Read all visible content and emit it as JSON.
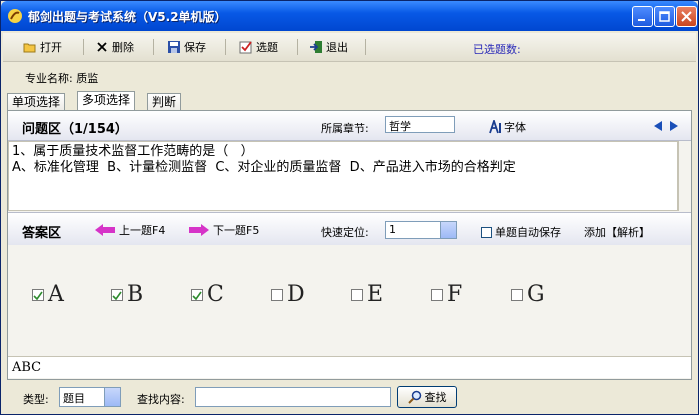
{
  "window": {
    "title": "郁剑出题与考试系统（V5.2单机版）"
  },
  "toolbar": {
    "open_label": "打开",
    "delete_label": "删除",
    "save_label": "保存",
    "select_label": "选题",
    "exit_label": "退出",
    "selected_count_label": "已选题数:"
  },
  "major": {
    "label": "专业名称: 质监"
  },
  "tabs": [
    {
      "label": "单项选择",
      "active": false
    },
    {
      "label": "多项选择",
      "active": true
    },
    {
      "label": "判断",
      "active": false
    }
  ],
  "question": {
    "area_title": "问题区（1/154）",
    "chapter_label": "所属章节:",
    "chapter_value": "哲学",
    "font_label": "字体",
    "text": "1、属于质量技术监督工作范畴的是（   ）\nA、标准化管理  B、计量检测监督  C、对企业的质量监督  D、产品进入市场的合格判定"
  },
  "answer": {
    "area_title": "答案区",
    "prev_label": "上一题F4",
    "next_label": "下一题F5",
    "locate_label": "快速定位:",
    "locate_value": "1",
    "autosave_label": "单题自动保存",
    "autosave_checked": false,
    "add_analysis_label": "添加【解析】",
    "options": [
      {
        "letter": "A",
        "checked": true
      },
      {
        "letter": "B",
        "checked": true
      },
      {
        "letter": "C",
        "checked": true
      },
      {
        "letter": "D",
        "checked": false
      },
      {
        "letter": "E",
        "checked": false
      },
      {
        "letter": "F",
        "checked": false
      },
      {
        "letter": "G",
        "checked": false
      }
    ],
    "result": "ABC"
  },
  "search": {
    "type_label": "类型:",
    "type_value": "题目",
    "content_label": "查找内容:",
    "content_value": "",
    "button_label": "查找"
  },
  "colors": {
    "titlebar": "#0859E6",
    "nav_arrow": "#CC33CC",
    "panel_header": "#E4E6F0"
  }
}
